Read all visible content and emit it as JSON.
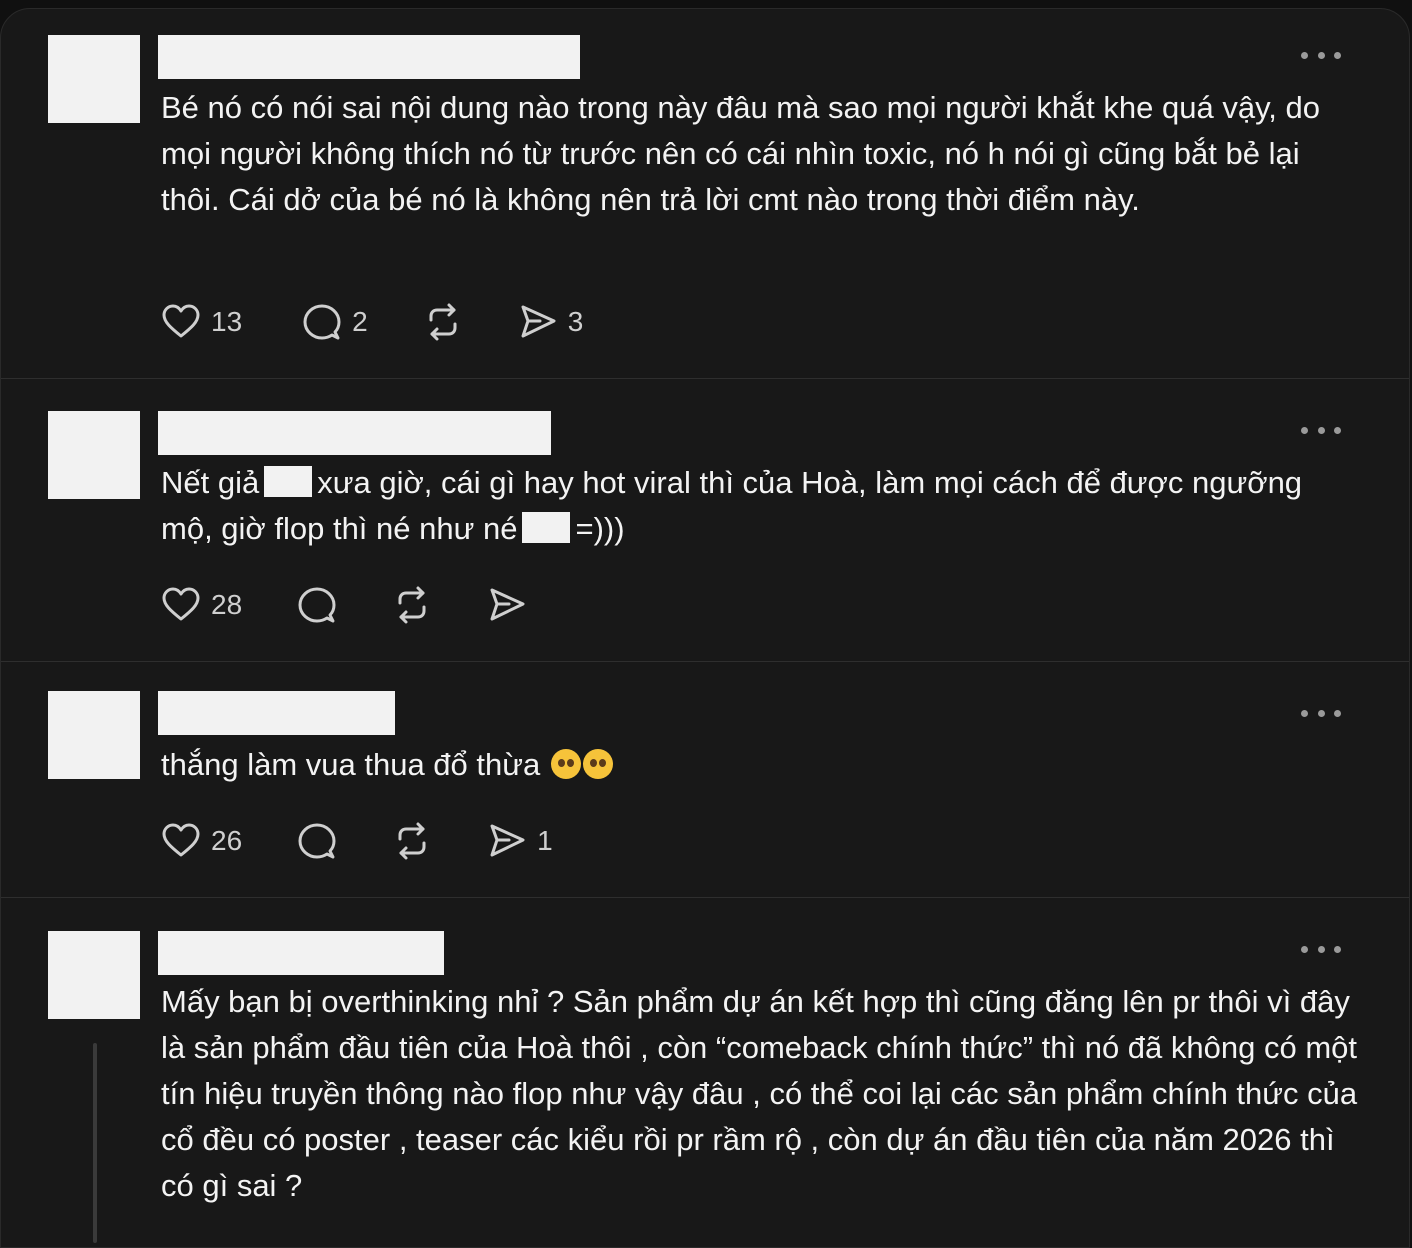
{
  "posts": [
    {
      "text": "Bé nó có nói sai nội dung nào trong này đâu mà sao mọi người khắt khe quá vậy, do mọi người không thích nó từ trước nên có cái nhìn toxic, nó h nói gì cũng bắt bẻ lại thôi. Cái dở của bé nó là không nên trả lời cmt nào trong thời điểm này.",
      "likes": "13",
      "replies": "2",
      "reposts": "",
      "shares": "3"
    },
    {
      "text_part1": "Nết giả",
      "text_part2": "xưa giờ, cái gì hay hot viral thì của Hoà, làm mọi cách để được ngưỡng mộ, giờ flop thì né như né",
      "text_part3": "=)))",
      "likes": "28",
      "replies": "",
      "reposts": "",
      "shares": ""
    },
    {
      "text": "thắng làm vua thua đổ thừa",
      "emoji": "pleading-face-emoji x2",
      "likes": "26",
      "replies": "",
      "reposts": "",
      "shares": "1"
    },
    {
      "text": "Mấy bạn bị overthinking nhỉ ? Sản phẩm dự án kết hợp thì cũng đăng lên pr thôi vì đây là sản phẩm đầu tiên của Hoà thôi , còn “comeback chính thức” thì nó đã không có một tín hiệu truyền thông nào flop như vậy đâu , có thể coi lại các sản phẩm chính thức của cổ đều có poster , teaser các kiểu rồi pr rầm rộ , còn dự án đầu tiên của năm 2026 thì có gì sai ?"
    }
  ],
  "icons": {
    "like": "heart-icon",
    "reply": "comment-bubble-icon",
    "repost": "repost-arrows-icon",
    "share": "send-icon",
    "more": "more-dots-icon"
  },
  "colors": {
    "background": "#181818",
    "text": "#f3f3f3",
    "muted": "#cfcfcf",
    "divider": "#2e2e2e"
  }
}
